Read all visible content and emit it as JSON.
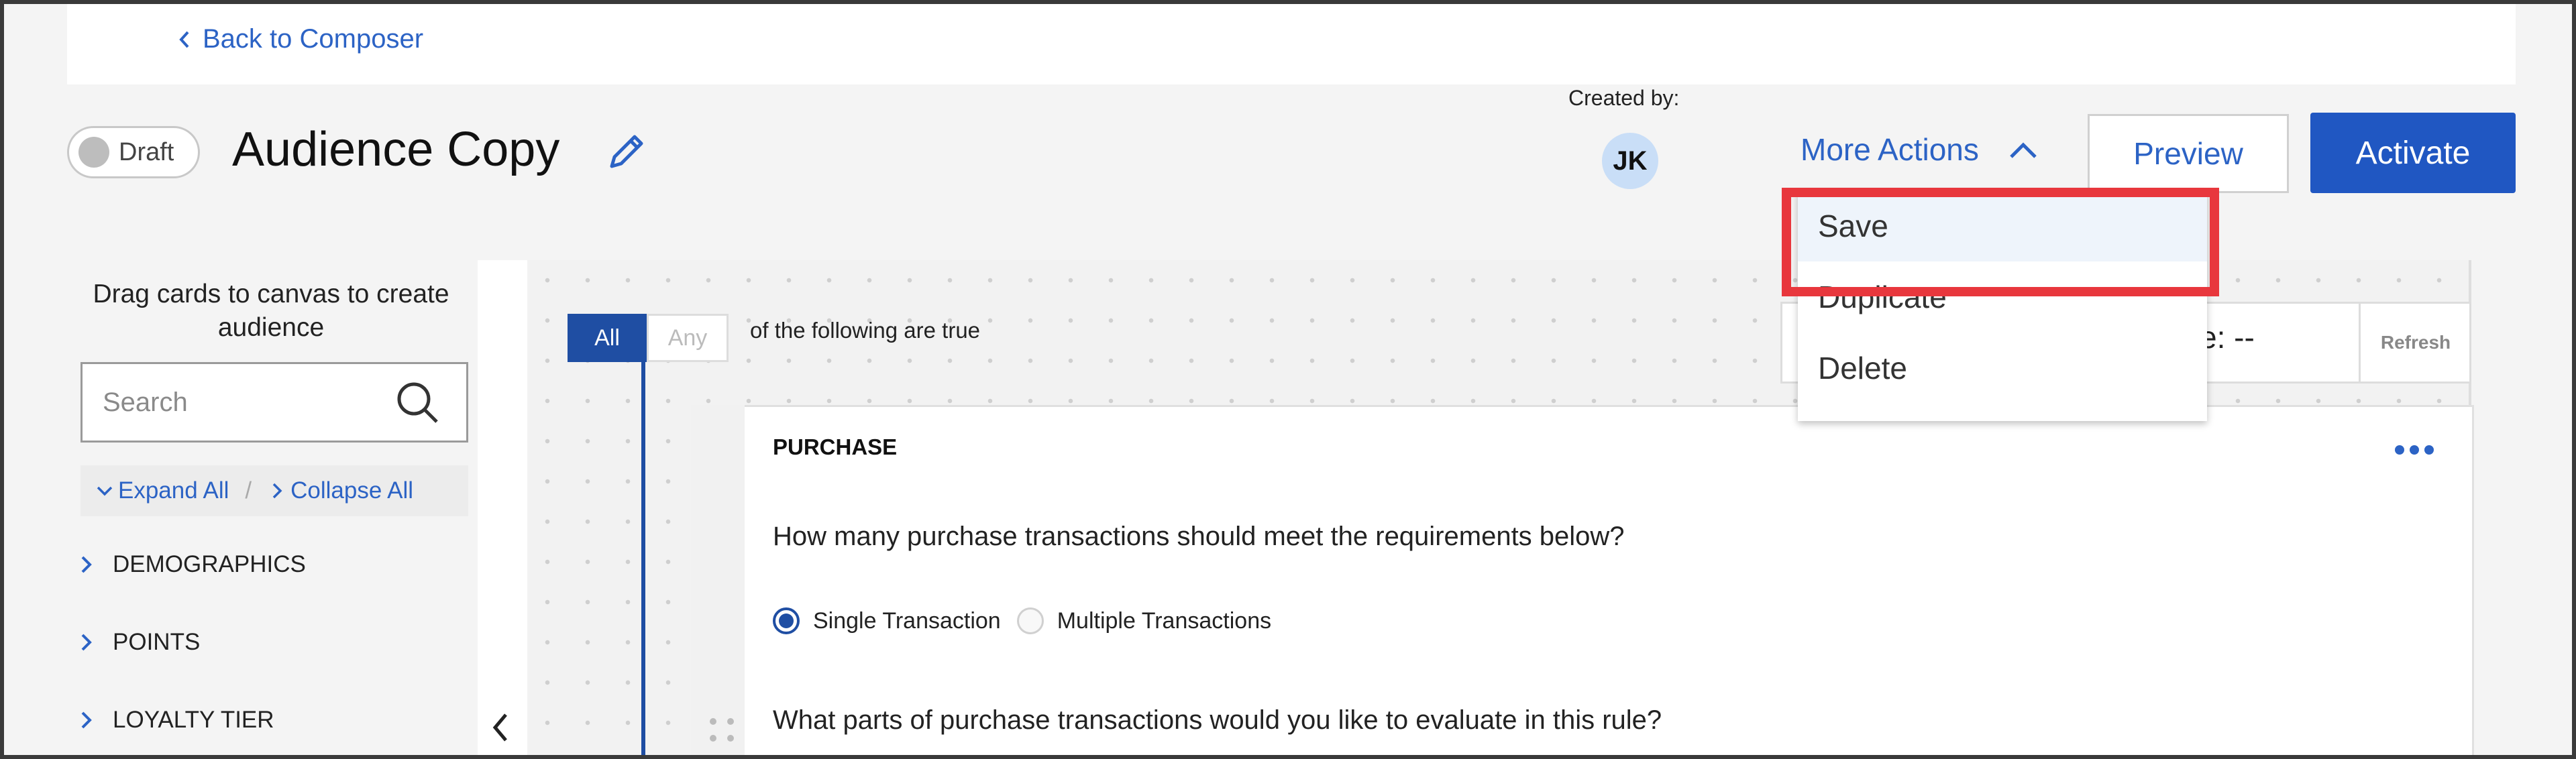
{
  "header": {
    "back_label": "Back to Composer",
    "status_toggle": "Draft",
    "title": "Audience Copy",
    "created_by_label": "Created by:",
    "creator_initials": "JK",
    "more_actions_label": "More Actions",
    "preview_label": "Preview",
    "activate_label": "Activate"
  },
  "more_actions_menu": {
    "items": [
      {
        "label": "Save"
      },
      {
        "label": "Duplicate"
      },
      {
        "label": "Delete"
      }
    ]
  },
  "sidebar": {
    "instruction": "Drag cards to canvas to create audience",
    "search_placeholder": "Search",
    "expand_all": "Expand All",
    "separator": "/",
    "collapse_all": "Collapse All",
    "categories": [
      {
        "label": "DEMOGRAPHICS"
      },
      {
        "label": "POINTS"
      },
      {
        "label": "LOYALTY TIER"
      }
    ]
  },
  "canvas": {
    "match_all": "All",
    "match_any": "Any",
    "match_suffix": "of the following are true",
    "size_label_partial": "ze: --",
    "refresh_label": "Refresh",
    "rule_card": {
      "title": "PURCHASE",
      "question1": "How many purchase transactions should meet the requirements below?",
      "option_single": "Single Transaction",
      "option_multiple": "Multiple Transactions",
      "selected": "Single Transaction",
      "question2": "What parts of purchase transactions would you like to evaluate in this rule?"
    }
  },
  "colors": {
    "accent_blue": "#2c63c5",
    "primary_button": "#2057c2",
    "highlight_red": "#e8373d"
  }
}
